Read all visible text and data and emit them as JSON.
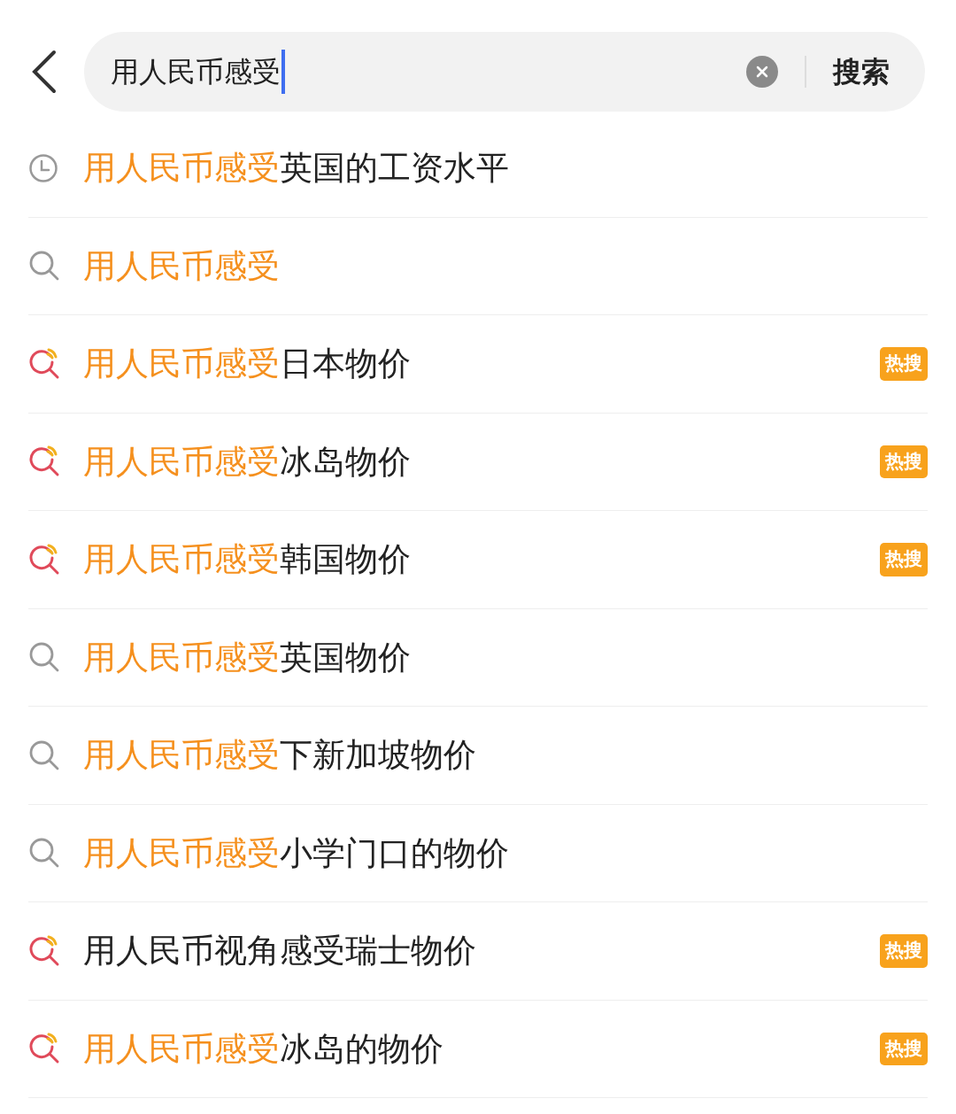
{
  "search": {
    "value": "用人民币感受",
    "button": "搜索"
  },
  "suggestions": [
    {
      "kind": "history",
      "match": "用人民币感受",
      "text": "英国的工资水平"
    },
    {
      "kind": "search",
      "match": "用人民币感受"
    },
    {
      "kind": "hot",
      "match": "用人民币感受",
      "text": "日本物价",
      "badge": "热搜"
    },
    {
      "kind": "hot",
      "match": "用人民币感受",
      "text": "冰岛物价",
      "badge": "热搜"
    },
    {
      "kind": "hot",
      "match": "用人民币感受",
      "text": "韩国物价",
      "badge": "热搜"
    },
    {
      "kind": "search",
      "match": "用人民币感受",
      "text": "英国物价"
    },
    {
      "kind": "search",
      "match": "用人民币感受",
      "text": "下新加坡物价"
    },
    {
      "kind": "search",
      "match": "用人民币感受",
      "text": "小学门口的物价"
    },
    {
      "kind": "hot",
      "text": "用人民币视角感受瑞士物价",
      "badge": "热搜"
    },
    {
      "kind": "hot",
      "match": "用人民币感受",
      "text": "冰岛的物价",
      "badge": "热搜"
    }
  ]
}
